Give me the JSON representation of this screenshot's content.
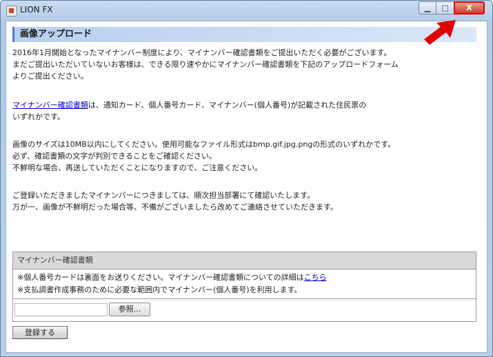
{
  "window": {
    "title": "LION FX",
    "min_glyph": "▁",
    "max_glyph": "□",
    "close_glyph": "X"
  },
  "page": {
    "heading": "画像アップロード",
    "p1": [
      "2016年1月開始となったマイナンバー制度により、マイナンバー確認書類をご提出いただく必要がございます。",
      "まだご提出いただいていないお客様は、できる限り速やかにマイナンバー確認書類を下記のアップロードフォーム",
      "よりご提出ください。"
    ],
    "p2": {
      "link": "マイナンバー確認書類",
      "line1_rest": "は、通知カード、個人番号カード、マイナンバー(個人番号)が記載された住民票の",
      "line2": "いずれかです。"
    },
    "p3": [
      "画像のサイズは10MB以内にしてください。使用可能なファイル形式はbmp.gif.jpg.pngの形式のいずれかです。",
      "必ず、確認書類の文字が判別できることをご確認ください。",
      "不鮮明な場合、再送していただくことになりますので、ご注意ください。"
    ],
    "p4": [
      "ご登録いただきましたマイナンバーにつきましては、順次担当部署にて確認いたします。",
      "万が一、画像が不鮮明だった場合等、不備がございましたら改めてご連絡させていただきます。"
    ]
  },
  "upload": {
    "section_label": "マイナンバー確認書類",
    "note1_text": "※個人番号カードは裏面をお送りください。マイナンバー確認書類についての詳細は",
    "note1_link": "こちら",
    "note2": "※支払調書作成事務のために必要な範囲内でマイナンバー(個人番号)を利用します。",
    "file_value": "",
    "browse_label": "参照..."
  },
  "submit_label": "登録する",
  "colors": {
    "accent": "#4f7fc7",
    "annotation_red": "#e00000"
  }
}
